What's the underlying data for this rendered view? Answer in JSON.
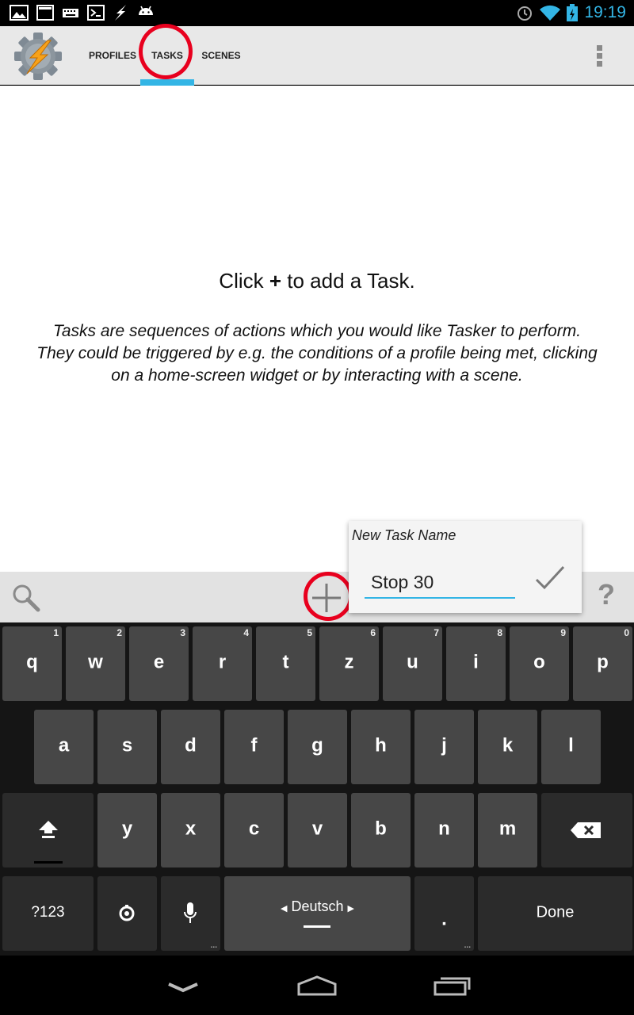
{
  "status_bar": {
    "time": "19:19",
    "left_icons": [
      "gallery-icon",
      "terminal-icon",
      "keyboard-icon",
      "shell-icon",
      "tasker-bolt-icon",
      "android-icon"
    ],
    "right_icons": [
      "alarm-icon",
      "wifi-icon",
      "battery-icon"
    ]
  },
  "action_bar": {
    "tabs": [
      {
        "label": "PROFILES",
        "selected": false
      },
      {
        "label": "TASKS",
        "selected": true
      },
      {
        "label": "SCENES",
        "selected": false
      }
    ],
    "accent_color": "#33b5e5",
    "overflow_icon": "overflow-menu-icon"
  },
  "content": {
    "empty_title_prefix": "Click ",
    "empty_title_plus": "+",
    "empty_title_suffix": " to add a Task.",
    "description_line1": "Tasks are sequences of actions which you would like Tasker to perform.",
    "description_line2": "They could be triggered by e.g. the conditions of a profile being met, clicking",
    "description_line3": "on a home-screen widget or by interacting with a scene."
  },
  "bottom_bar": {
    "search_icon": "search-icon",
    "add_icon": "plus-icon",
    "help_label": "?"
  },
  "popup": {
    "title": "New Task Name",
    "input_value": "Stop 30",
    "confirm_icon": "checkmark-icon"
  },
  "keyboard": {
    "row1": [
      {
        "label": "q",
        "hint": "1"
      },
      {
        "label": "w",
        "hint": "2"
      },
      {
        "label": "e",
        "hint": "3"
      },
      {
        "label": "r",
        "hint": "4"
      },
      {
        "label": "t",
        "hint": "5"
      },
      {
        "label": "z",
        "hint": "6"
      },
      {
        "label": "u",
        "hint": "7"
      },
      {
        "label": "i",
        "hint": "8"
      },
      {
        "label": "o",
        "hint": "9"
      },
      {
        "label": "p",
        "hint": "0"
      }
    ],
    "row2": [
      "a",
      "s",
      "d",
      "f",
      "g",
      "h",
      "j",
      "k",
      "l"
    ],
    "row3": [
      "y",
      "x",
      "c",
      "v",
      "b",
      "n",
      "m"
    ],
    "symbols_label": "?123",
    "language_label": "Deutsch",
    "period_label": ".",
    "done_label": "Done"
  },
  "annotation_color": "#e8001e"
}
